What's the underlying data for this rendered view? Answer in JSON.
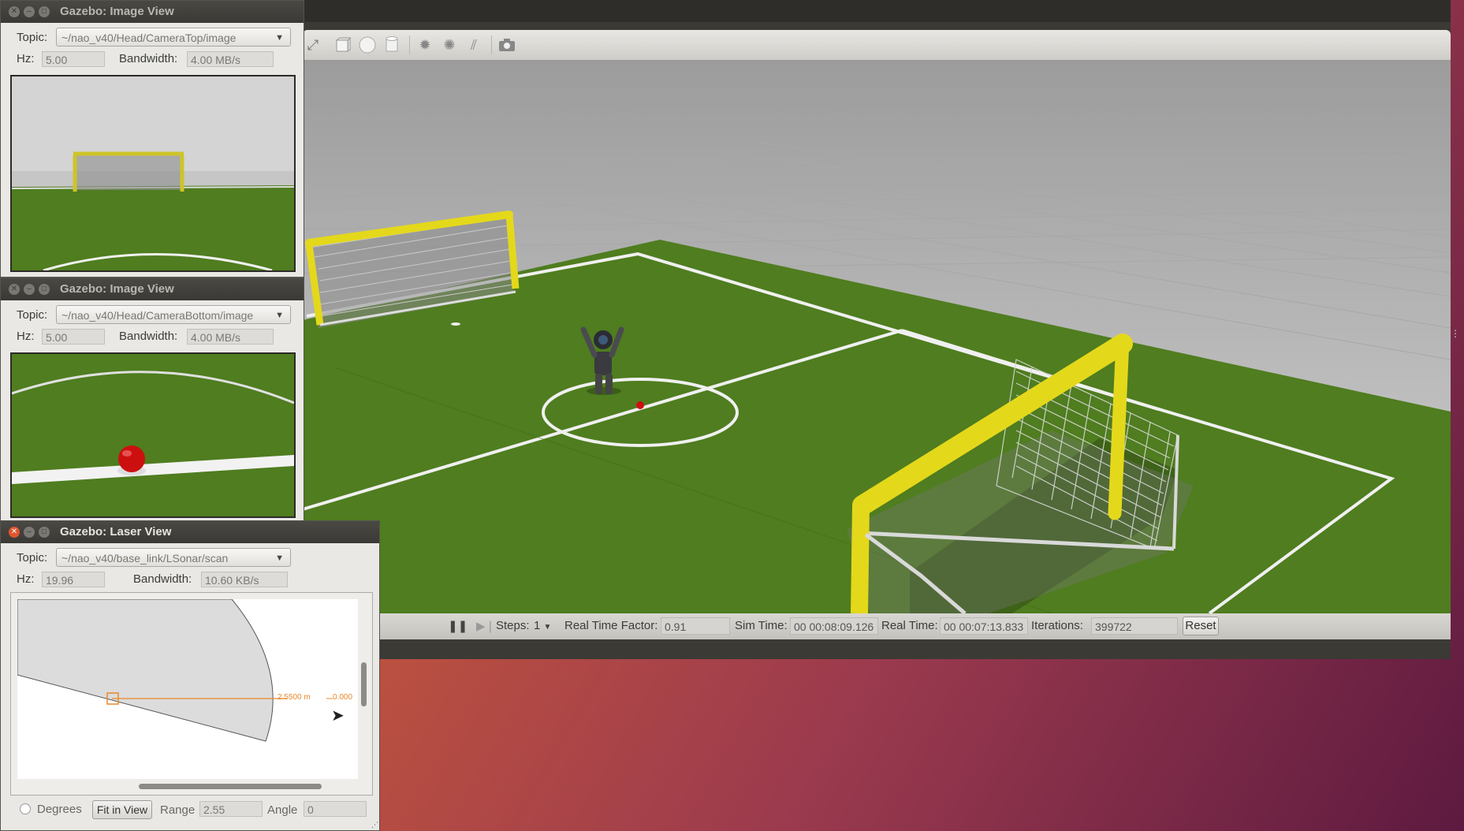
{
  "main_window": {
    "toolbar_icons": [
      "scale-icon",
      "box-icon",
      "sphere-icon",
      "cylinder-icon",
      "sun-light-icon",
      "spot-light-icon",
      "directional-light-icon",
      "camera-screenshot-icon"
    ],
    "bottom_bar": {
      "pause_label": "❚❚",
      "step_label": "▶❘",
      "steps_label": "Steps:",
      "steps_value": "1",
      "rtf_label": "Real Time Factor:",
      "rtf_value": "0.91",
      "sim_time_label": "Sim Time:",
      "sim_time_value": "00 00:08:09.126",
      "real_time_label": "Real Time:",
      "real_time_value": "00 00:07:13.833",
      "iterations_label": "Iterations:",
      "iterations_value": "399722",
      "reset_label": "Reset"
    }
  },
  "image_view_top": {
    "title": "Gazebo: Image View",
    "topic_label": "Topic:",
    "topic_value": "~/nao_v40/Head/CameraTop/image",
    "hz_label": "Hz:",
    "hz_value": "5.00",
    "bandwidth_label": "Bandwidth:",
    "bandwidth_value": "4.00 MB/s"
  },
  "image_view_bottom": {
    "title": "Gazebo: Image View",
    "topic_label": "Topic:",
    "topic_value": "~/nao_v40/Head/CameraBottom/image",
    "hz_label": "Hz:",
    "hz_value": "5.00",
    "bandwidth_label": "Bandwidth:",
    "bandwidth_value": "4.00 MB/s"
  },
  "laser_view": {
    "title": "Gazebo: Laser View",
    "topic_label": "Topic:",
    "topic_value": "~/nao_v40/base_link/LSonar/scan",
    "hz_label": "Hz:",
    "hz_value": "19.96",
    "bandwidth_label": "Bandwidth:",
    "bandwidth_value": "10.60 KB/s",
    "range_readout": "2.5500 m",
    "angle_readout": "0.000",
    "degrees_label": "Degrees",
    "fit_label": "Fit in View",
    "range_label": "Range",
    "range_value": "2.55",
    "angle_label": "Angle",
    "angle_value": "0"
  },
  "colors": {
    "field_green": "#4f7d1f",
    "goal_yellow": "#e4d81b",
    "ball_red": "#cc1010",
    "laser_orange": "#e8882a"
  }
}
